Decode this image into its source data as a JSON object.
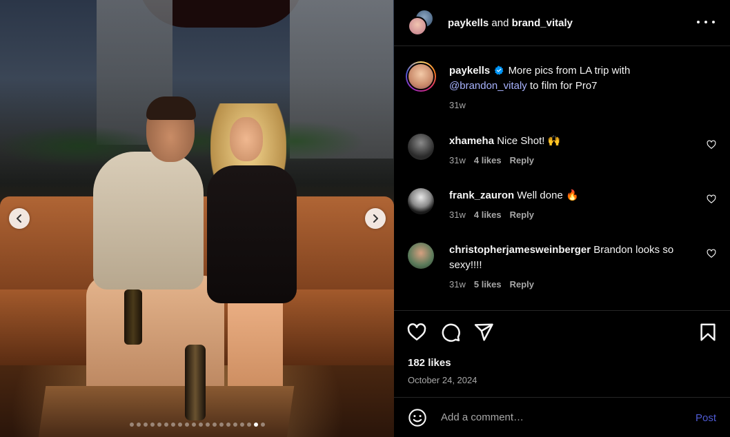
{
  "header": {
    "user1": "paykells",
    "conjunction": "and",
    "user2": "brand_vitaly"
  },
  "caption": {
    "username": "paykells",
    "verified": true,
    "text_before": "More pics from LA trip with",
    "mention": "@brandon_vitaly",
    "text_after": "to film for Pro7",
    "age": "31w"
  },
  "comments": [
    {
      "username": "xhameha",
      "text": "Nice Shot! 🙌",
      "age": "31w",
      "likes": "4 likes",
      "reply": "Reply"
    },
    {
      "username": "frank_zauron",
      "text": "Well done 🔥",
      "age": "31w",
      "likes": "4 likes",
      "reply": "Reply"
    },
    {
      "username": "christopherjamesweinberger",
      "text": "Brandon looks so sexy!!!!",
      "age": "31w",
      "likes": "5 likes",
      "reply": "Reply"
    }
  ],
  "post": {
    "likes": "182 likes",
    "date": "October 24, 2024"
  },
  "composer": {
    "placeholder": "Add a comment…",
    "post_label": "Post"
  },
  "carousel": {
    "total": 20,
    "active_index": 18
  },
  "colors": {
    "background": "#000000",
    "text": "#f5f5f5",
    "muted": "#a8a8a8",
    "mention": "#a8b3ff",
    "post_button": "#4f5bd5",
    "verified": "#0095f6",
    "divider": "#262626"
  },
  "icons": [
    "chevron-left-icon",
    "chevron-right-icon",
    "more-icon",
    "verified-icon",
    "heart-icon",
    "comment-icon",
    "share-icon",
    "bookmark-icon",
    "emoji-icon"
  ]
}
